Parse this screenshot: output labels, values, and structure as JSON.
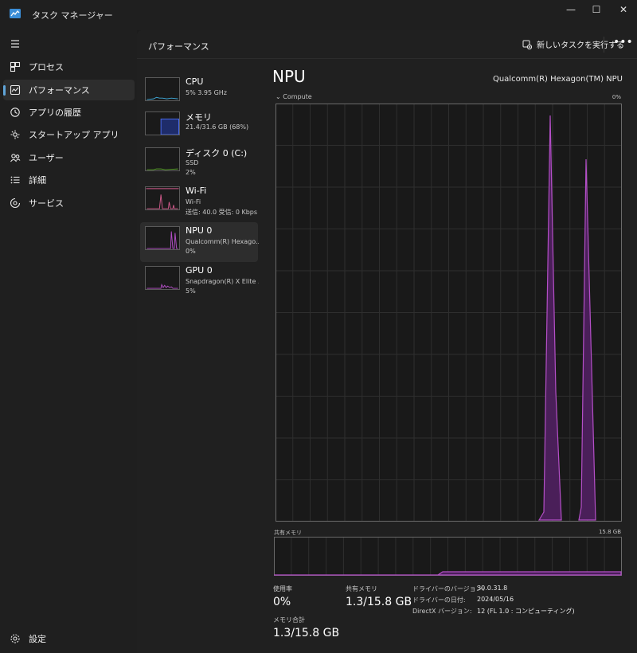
{
  "window": {
    "title": "タスク マネージャー",
    "minimize": "—",
    "maximize": "☐",
    "close": "✕"
  },
  "nav": {
    "items": [
      {
        "label": "プロセス",
        "icon": "grid-icon"
      },
      {
        "label": "パフォーマンス",
        "icon": "performance-icon",
        "active": true
      },
      {
        "label": "アプリの履歴",
        "icon": "history-icon"
      },
      {
        "label": "スタートアップ アプリ",
        "icon": "startup-icon"
      },
      {
        "label": "ユーザー",
        "icon": "users-icon"
      },
      {
        "label": "詳細",
        "icon": "list-icon"
      },
      {
        "label": "サービス",
        "icon": "services-icon"
      }
    ],
    "settings_label": "設定"
  },
  "header": {
    "title": "パフォーマンス",
    "run_task_label": "新しいタスクを実行する",
    "more_label": "•••"
  },
  "devices": [
    {
      "name": "CPU",
      "sub": "5%  3.95 GHz",
      "sub2": "",
      "color": "#3fa7d6"
    },
    {
      "name": "メモリ",
      "sub": "21.4/31.6 GB (68%)",
      "sub2": "",
      "color": "#4a6cf0"
    },
    {
      "name": "ディスク 0 (C:)",
      "sub": "SSD",
      "sub2": "2%",
      "color": "#5aa02c"
    },
    {
      "name": "Wi-Fi",
      "sub": "Wi-Fi",
      "sub2": "送信: 40.0  受信: 0 Kbps",
      "color": "#d25a8c"
    },
    {
      "name": "NPU 0",
      "sub": "Qualcomm(R) Hexago...",
      "sub2": "0%",
      "color": "#b44fc7",
      "active": true
    },
    {
      "name": "GPU 0",
      "sub": "Snapdragon(R) X Elite ...",
      "sub2": "5%",
      "color": "#b44fc7"
    }
  ],
  "detail": {
    "title": "NPU",
    "model": "Qualcomm(R) Hexagon(TM) NPU",
    "compute_label": "Compute",
    "compute_max": "0%",
    "shared_label": "共有メモリ",
    "shared_max": "15.8 GB",
    "accent": "#b44fc7",
    "stats": {
      "usage_label": "使用率",
      "usage_value": "0%",
      "shared_label": "共有メモリ",
      "shared_value": "1.3/15.8 GB",
      "total_label": "メモリ合計",
      "total_value": "1.3/15.8 GB"
    },
    "info": [
      {
        "k": "ドライバーのバージョン:",
        "v": "30.0.31.8"
      },
      {
        "k": "ドライバーの日付:",
        "v": "2024/05/16"
      },
      {
        "k": "DirectX バージョン:",
        "v": "12 (FL 1.0 : コンピューティング)"
      }
    ]
  }
}
